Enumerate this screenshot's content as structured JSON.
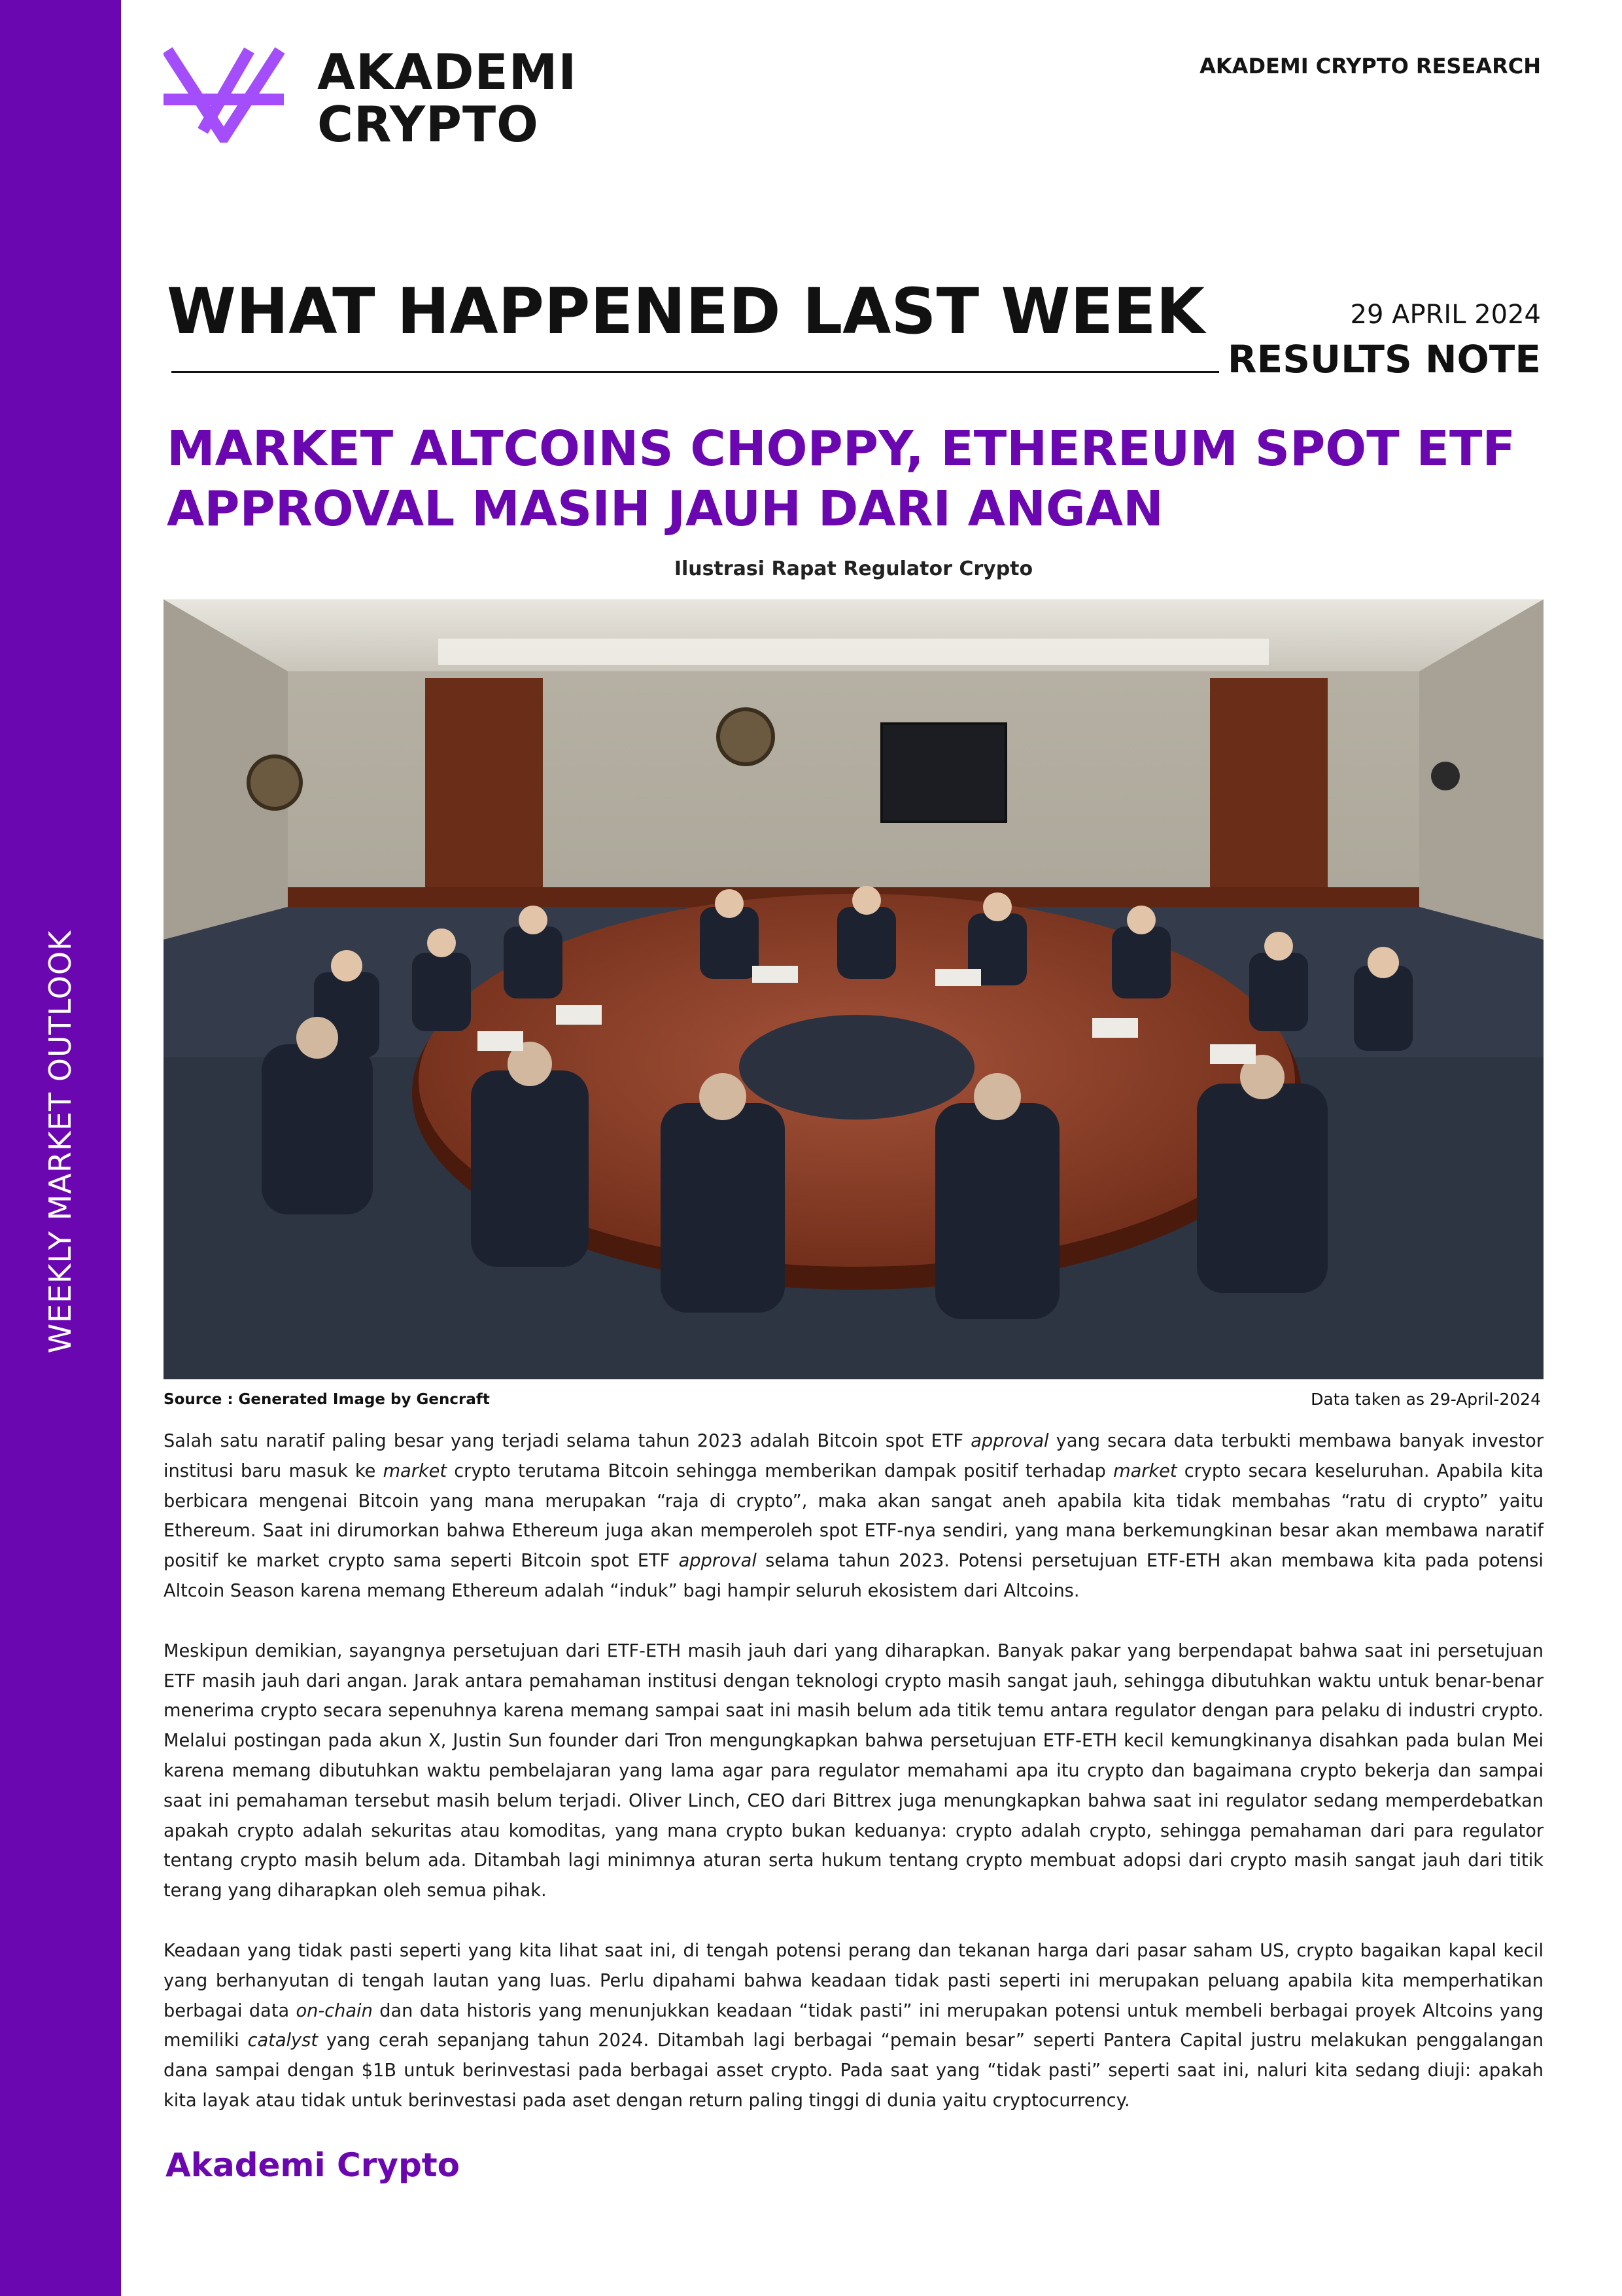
{
  "sidebar": {
    "label": "WEEKLY MARKET OUTLOOK"
  },
  "header": {
    "logo_icon": "akademi-crypto-logo",
    "brand_line1": "AKADEMI",
    "brand_line2": "CRYPTO",
    "research_label": "AKADEMI CRYPTO RESEARCH"
  },
  "section": {
    "title": "WHAT HAPPENED LAST WEEK",
    "date": "29 APRIL 2024",
    "note_type": "RESULTS NOTE"
  },
  "headline": "MARKET ALTCOINS CHOPPY, ETHEREUM SPOT ETF APPROVAL MASIH JAUH DARI ANGAN",
  "figure": {
    "caption": "Ilustrasi Rapat Regulator Crypto",
    "image_subject": "regulators-meeting-photo",
    "source": "Source : Generated Image by Gencraft",
    "data_taken": "Data taken as 29-April-2024"
  },
  "body": {
    "p1": [
      "Salah satu naratif paling besar yang terjadi selama tahun 2023 adalah Bitcoin spot ETF ",
      "approval",
      " yang secara data terbukti membawa banyak investor institusi baru masuk ke ",
      "market",
      " crypto terutama Bitcoin sehingga memberikan dampak positif terhadap ",
      "market",
      " crypto secara keseluruhan. Apabila kita berbicara mengenai Bitcoin yang mana merupakan “raja di crypto”, maka akan sangat aneh apabila kita tidak membahas “ratu di crypto” yaitu Ethereum. Saat ini dirumorkan bahwa Ethereum juga akan memperoleh spot ETF-nya sendiri, yang mana berkemungkinan besar akan membawa naratif positif ke market crypto sama seperti Bitcoin spot ETF ",
      "approval",
      " selama tahun 2023. Potensi persetujuan ETF-ETH akan membawa kita pada potensi Altcoin Season karena memang Ethereum adalah “induk” bagi hampir seluruh ekosistem dari Altcoins."
    ],
    "p2": "Meskipun demikian, sayangnya persetujuan dari ETF-ETH masih jauh dari yang diharapkan. Banyak pakar yang berpendapat bahwa saat ini persetujuan ETF masih jauh dari angan. Jarak antara pemahaman institusi dengan teknologi crypto masih sangat jauh, sehingga dibutuhkan waktu untuk benar-benar menerima crypto secara sepenuhnya karena memang sampai saat ini masih belum ada titik temu antara regulator dengan para pelaku di industri crypto. Melalui postingan pada akun X, Justin Sun founder dari Tron mengungkapkan bahwa persetujuan ETF-ETH kecil kemungkinanya disahkan pada bulan Mei karena memang dibutuhkan waktu pembelajaran yang lama agar para regulator memahami apa itu crypto dan bagaimana crypto bekerja dan sampai saat ini pemahaman tersebut masih belum terjadi. Oliver Linch, CEO dari Bittrex juga menungkapkan bahwa saat ini regulator sedang memperdebatkan apakah crypto adalah sekuritas atau komoditas, yang mana crypto bukan keduanya: crypto adalah crypto, sehingga pemahaman dari para regulator tentang crypto masih belum ada. Ditambah lagi minimnya aturan serta hukum tentang crypto membuat adopsi dari crypto masih sangat jauh dari titik terang yang diharapkan oleh semua pihak.",
    "p3": [
      "Keadaan yang tidak pasti seperti yang kita lihat saat ini, di tengah potensi perang dan tekanan harga dari pasar saham US, crypto bagaikan kapal kecil yang berhanyutan di tengah lautan yang luas. Perlu dipahami bahwa keadaan tidak pasti seperti ini merupakan peluang apabila kita memperhatikan berbagai data ",
      "on-chain",
      " dan data historis yang menunjukkan keadaan “tidak pasti” ini merupakan potensi untuk membeli berbagai proyek Altcoins yang memiliki ",
      "catalyst",
      " yang cerah sepanjang tahun 2024. Ditambah lagi berbagai “pemain besar” seperti Pantera Capital justru melakukan penggalangan dana sampai dengan $1B untuk berinvestasi pada berbagai asset crypto. Pada saat yang “tidak pasti” seperti saat ini, naluri kita sedang diuji: apakah kita layak atau tidak untuk berinvestasi pada aset dengan return paling tinggi di dunia yaitu cryptocurrency."
    ]
  },
  "footer": {
    "brand": "Akademi Crypto"
  },
  "colors": {
    "brand_purple": "#6a07b0",
    "text": "#111111",
    "background": "#ffffff"
  }
}
